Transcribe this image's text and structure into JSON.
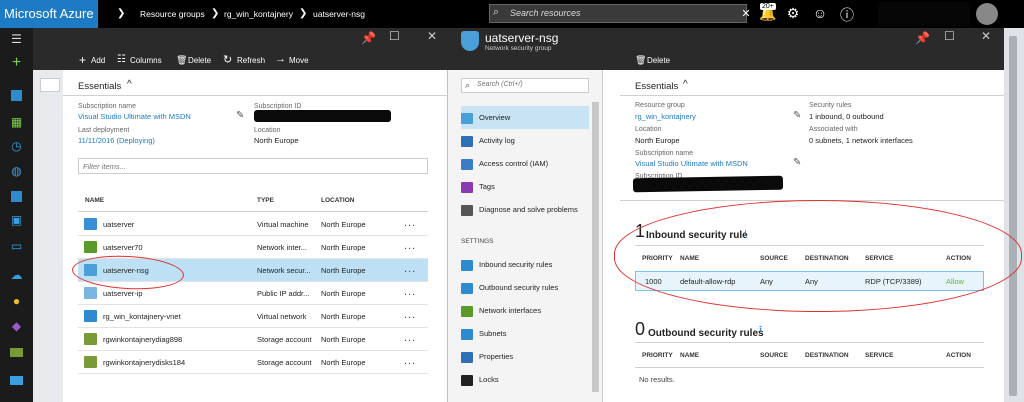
{
  "topbar": {
    "brand": "Microsoft Azure",
    "crumbs": [
      "Resource groups",
      "rg_win_kontajnery",
      "uatserver-nsg"
    ],
    "search_placeholder": "Search resources",
    "notif_count": "20+"
  },
  "leftnav": {
    "icons": [
      "hamburger-icon",
      "new-plus-icon",
      "cube-icon",
      "dashboard-grid-icon",
      "clock-icon",
      "globe-icon",
      "sql-icon",
      "monitor-icon",
      "vm-icon",
      "cloud-icon",
      "bulb-icon",
      "shield-icon",
      "storage-icon",
      "card-icon"
    ]
  },
  "blade1": {
    "toolbar": {
      "add": "Add",
      "columns": "Columns",
      "delete": "Delete",
      "refresh": "Refresh",
      "move": "Move"
    },
    "essentials": "Essentials",
    "sub_name_label": "Subscription name",
    "sub_name_value": "Visual Studio Ultimate with MSDN",
    "last_deploy_label": "Last deployment",
    "last_deploy_value": "11/11/2016 (Deploying)",
    "sub_id_label": "Subscription ID",
    "location_label": "Location",
    "location_value": "North Europe",
    "filter_placeholder": "Filter items...",
    "columns": {
      "name": "NAME",
      "type": "TYPE",
      "location": "LOCATION"
    },
    "rows": [
      {
        "name": "uatserver",
        "type": "Virtual machine",
        "location": "North Europe",
        "more": "...",
        "icon": "vm-icon",
        "color": "#3a8fd6"
      },
      {
        "name": "uatserver70",
        "type": "Network inter...",
        "location": "North Europe",
        "more": "...",
        "icon": "nic-icon",
        "color": "#5a9a2a"
      },
      {
        "name": "uatserver-nsg",
        "type": "Network secur...",
        "location": "North Europe",
        "more": "...",
        "icon": "nsg-shield-icon",
        "color": "#4a9fd8"
      },
      {
        "name": "uatserver-ip",
        "type": "Public IP addr...",
        "location": "North Europe",
        "more": "...",
        "icon": "ip-icon",
        "color": "#7ab6e0"
      },
      {
        "name": "rg_win_kontajnery-vnet",
        "type": "Virtual network",
        "location": "North Europe",
        "more": "...",
        "icon": "vnet-icon",
        "color": "#2e8bd0"
      },
      {
        "name": "rgwinkontajnerydiag898",
        "type": "Storage account",
        "location": "North Europe",
        "more": "...",
        "icon": "storage-icon",
        "color": "#7a9a3a"
      },
      {
        "name": "rgwinkontajnerydisks184",
        "type": "Storage account",
        "location": "North Europe",
        "more": "...",
        "icon": "storage-icon",
        "color": "#7a9a3a"
      }
    ]
  },
  "blade2": {
    "title": "uatserver-nsg",
    "subtitle": "Network security group",
    "toolbar_delete": "Delete",
    "search_placeholder": "Search (Ctrl+/)",
    "menu": [
      {
        "label": "Overview",
        "icon": "shield-icon",
        "color": "#4a9fd8"
      },
      {
        "label": "Activity log",
        "icon": "log-icon",
        "color": "#2e6fb8"
      },
      {
        "label": "Access control (IAM)",
        "icon": "iam-icon",
        "color": "#3a7dc6"
      },
      {
        "label": "Tags",
        "icon": "tag-icon",
        "color": "#8a3ab0"
      },
      {
        "label": "Diagnose and solve problems",
        "icon": "wrench-icon",
        "color": "#555"
      }
    ],
    "settings_label": "SETTINGS",
    "settings_menu": [
      {
        "label": "Inbound security rules",
        "icon": "inbound-icon",
        "color": "#2e8bd0"
      },
      {
        "label": "Outbound security rules",
        "icon": "outbound-icon",
        "color": "#2e8bd0"
      },
      {
        "label": "Network interfaces",
        "icon": "nic-icon",
        "color": "#5a9a2a"
      },
      {
        "label": "Subnets",
        "icon": "subnet-icon",
        "color": "#2e8bd0"
      },
      {
        "label": "Properties",
        "icon": "properties-icon",
        "color": "#2e6fb8"
      },
      {
        "label": "Locks",
        "icon": "lock-icon",
        "color": "#222"
      }
    ],
    "essentials": "Essentials",
    "rg_label": "Resource group",
    "rg_value": "rg_win_kontajnery",
    "loc_label": "Location",
    "loc_value": "North Europe",
    "subname_label": "Subscription name",
    "subname_value": "Visual Studio Ultimate with MSDN",
    "subid_label": "Subscription ID",
    "secrules_label": "Security rules",
    "secrules_value": "1 inbound, 0 outbound",
    "assoc_label": "Associated with",
    "assoc_value": "0 subnets, 1 network interfaces",
    "inbound": {
      "count": "1",
      "title": "Inbound security rule",
      "cols": {
        "priority": "PRIORITY",
        "name": "NAME",
        "source": "SOURCE",
        "destination": "DESTINATION",
        "service": "SERVICE",
        "action": "ACTION"
      },
      "row": {
        "priority": "1000",
        "name": "default-allow-rdp",
        "source": "Any",
        "destination": "Any",
        "service": "RDP (TCP/3389)",
        "action": "Allow"
      }
    },
    "outbound": {
      "count": "0",
      "title": "Outbound security rules",
      "cols": {
        "priority": "PRIORITY",
        "name": "NAME",
        "source": "SOURCE",
        "destination": "DESTINATION",
        "service": "SERVICE",
        "action": "ACTION"
      },
      "empty": "No results."
    }
  },
  "colors": {
    "accent": "#1c7bc4",
    "selected_row": "#bde0f5",
    "allow": "#5cb82e",
    "annotation": "#e03030"
  }
}
